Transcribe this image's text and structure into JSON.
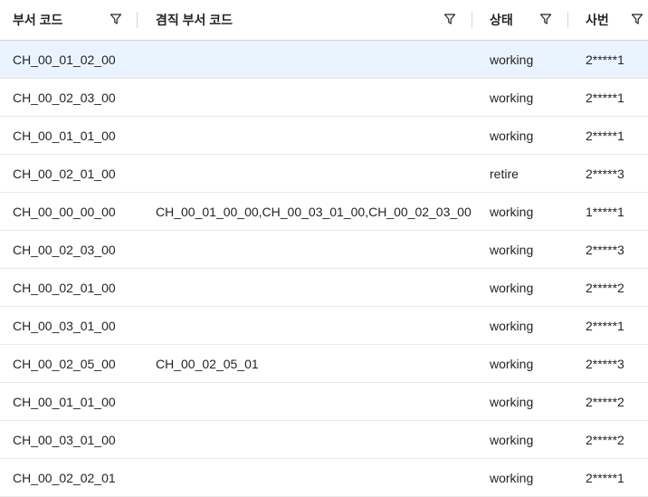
{
  "columns": [
    {
      "label": "부서 코드",
      "filter_icon": "filter-icon"
    },
    {
      "label": "겸직 부서 코드",
      "filter_icon": "filter-icon"
    },
    {
      "label": "상태",
      "filter_icon": "filter-icon"
    },
    {
      "label": "사번",
      "filter_icon": "filter-icon"
    }
  ],
  "colors": {
    "selected_row": "#eaf4ff",
    "border": "#e8e8e8",
    "text": "#242424"
  },
  "rows": [
    {
      "dept": "CH_00_01_02_00",
      "concurrent": "",
      "status": "working",
      "emp": "2*****1",
      "selected": true
    },
    {
      "dept": "CH_00_02_03_00",
      "concurrent": "",
      "status": "working",
      "emp": "2*****1"
    },
    {
      "dept": "CH_00_01_01_00",
      "concurrent": "",
      "status": "working",
      "emp": "2*****1"
    },
    {
      "dept": "CH_00_02_01_00",
      "concurrent": "",
      "status": "retire",
      "emp": "2*****3"
    },
    {
      "dept": "CH_00_00_00_00",
      "concurrent": "CH_00_01_00_00,CH_00_03_01_00,CH_00_02_03_00",
      "status": "working",
      "emp": "1*****1"
    },
    {
      "dept": "CH_00_02_03_00",
      "concurrent": "",
      "status": "working",
      "emp": "2*****3"
    },
    {
      "dept": "CH_00_02_01_00",
      "concurrent": "",
      "status": "working",
      "emp": "2*****2"
    },
    {
      "dept": "CH_00_03_01_00",
      "concurrent": "",
      "status": "working",
      "emp": "2*****1"
    },
    {
      "dept": "CH_00_02_05_00",
      "concurrent": "CH_00_02_05_01",
      "status": "working",
      "emp": "2*****3"
    },
    {
      "dept": "CH_00_01_01_00",
      "concurrent": "",
      "status": "working",
      "emp": "2*****2"
    },
    {
      "dept": "CH_00_03_01_00",
      "concurrent": "",
      "status": "working",
      "emp": "2*****2"
    },
    {
      "dept": "CH_00_02_02_01",
      "concurrent": "",
      "status": "working",
      "emp": "2*****1"
    }
  ]
}
